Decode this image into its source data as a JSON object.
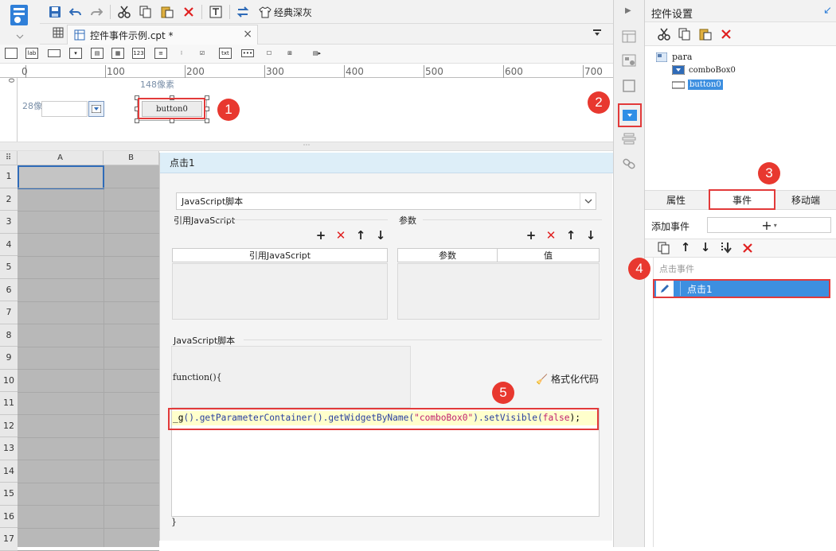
{
  "toolbar": {
    "theme_label": "经典深灰"
  },
  "file_tab": {
    "name": "控件事件示例.cpt *"
  },
  "ruler": {
    "marks": [
      "0",
      "100",
      "200",
      "300",
      "400",
      "500",
      "600",
      "700"
    ],
    "vmark": "0"
  },
  "canvas": {
    "width_label": "148像素",
    "height_label": "28像素",
    "button_text": "button0"
  },
  "sheet": {
    "columns": [
      "A",
      "B"
    ],
    "rows": [
      "1",
      "2",
      "3",
      "4",
      "5",
      "6",
      "7",
      "8",
      "9",
      "10",
      "11",
      "12",
      "13",
      "14",
      "15",
      "16",
      "17"
    ]
  },
  "dialog": {
    "title": "点击1",
    "type_select": "JavaScript脚本",
    "ref_js_label": "引用JavaScript",
    "params_label": "参数",
    "ref_js_col": "引用JavaScript",
    "param_col": "参数",
    "value_col": "值",
    "script_label": "JavaScript脚本",
    "func_open": "function(){",
    "format_label": "格式化代码",
    "code": {
      "p1": "_g",
      "p2": "().getParameterContainer().getWidgetByName(",
      "p3": "\"comboBox0\"",
      "p4": ").setVisible(",
      "p5": "false",
      "p6": ");"
    },
    "func_close": "}"
  },
  "right_panel": {
    "title": "控件设置",
    "tree": {
      "root": "para",
      "child1": "comboBox0",
      "child2": "button0"
    },
    "tabs": [
      "属性",
      "事件",
      "移动端"
    ],
    "add_event_label": "添加事件",
    "add_symbol": "+",
    "event_group": "点击事件",
    "event_item": "点击1"
  },
  "badges": [
    "1",
    "2",
    "3",
    "4",
    "5"
  ],
  "colors": {
    "accent": "#3d8fe0",
    "badge": "#e8382f",
    "highlight": "#2f8fe6",
    "code_bg": "#ffffcc"
  }
}
